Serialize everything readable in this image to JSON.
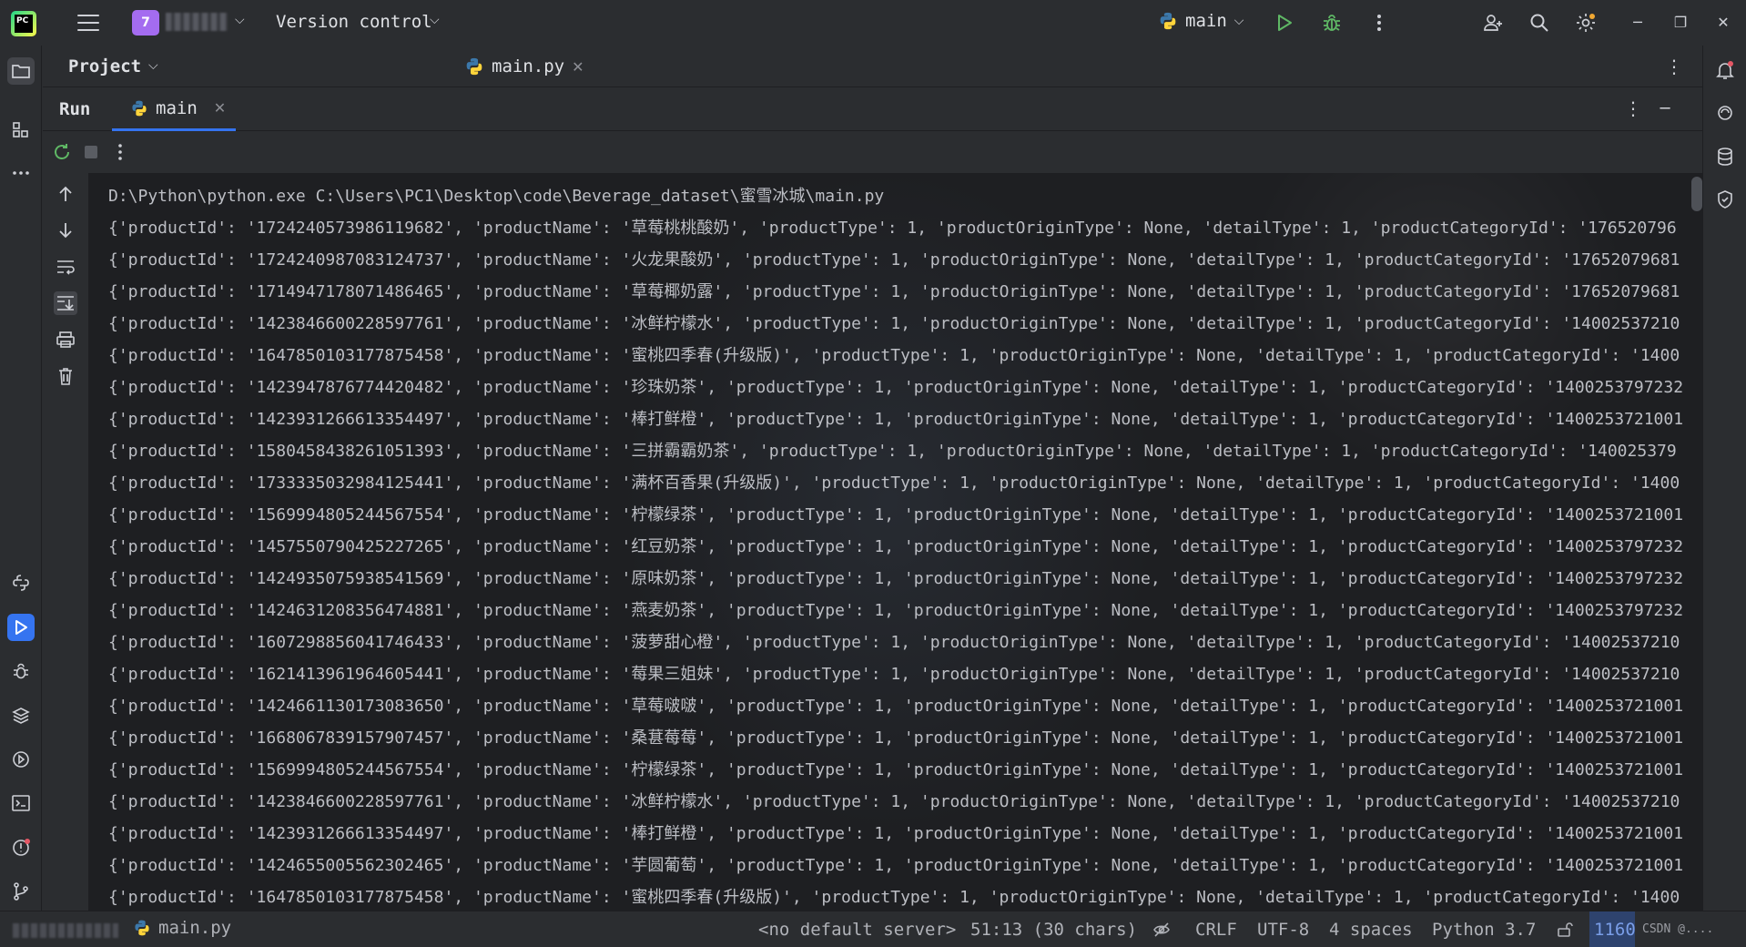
{
  "titlebar": {
    "logo_text": "PC",
    "project_badge": "7",
    "version_control": "Version control",
    "run_config": "main"
  },
  "project_panel": {
    "title": "Project"
  },
  "editor": {
    "tabs": [
      {
        "label": "main.py"
      }
    ]
  },
  "run_panel": {
    "title": "Run",
    "tab_label": "main"
  },
  "console": {
    "lines": [
      "D:\\Python\\python.exe C:\\Users\\PC1\\Desktop\\code\\Beverage_dataset\\蜜雪冰城\\main.py",
      "{'productId': '1724240573986119682', 'productName': '草莓桃桃酸奶', 'productType': 1, 'productOriginType': None, 'detailType': 1, 'productCategoryId': '176520796",
      "{'productId': '1724240987083124737', 'productName': '火龙果酸奶', 'productType': 1, 'productOriginType': None, 'detailType': 1, 'productCategoryId': '17652079681",
      "{'productId': '1714947178071486465', 'productName': '草莓椰奶露', 'productType': 1, 'productOriginType': None, 'detailType': 1, 'productCategoryId': '17652079681",
      "{'productId': '1423846600228597761', 'productName': '冰鲜柠檬水', 'productType': 1, 'productOriginType': None, 'detailType': 1, 'productCategoryId': '14002537210",
      "{'productId': '1647850103177875458', 'productName': '蜜桃四季春(升级版)', 'productType': 1, 'productOriginType': None, 'detailType': 1, 'productCategoryId': '1400",
      "{'productId': '1423947876774420482', 'productName': '珍珠奶茶', 'productType': 1, 'productOriginType': None, 'detailType': 1, 'productCategoryId': '1400253797232",
      "{'productId': '1423931266613354497', 'productName': '棒打鲜橙', 'productType': 1, 'productOriginType': None, 'detailType': 1, 'productCategoryId': '1400253721001",
      "{'productId': '1580458438261051393', 'productName': '三拼霸霸奶茶', 'productType': 1, 'productOriginType': None, 'detailType': 1, 'productCategoryId': '140025379",
      "{'productId': '1733335032984125441', 'productName': '满杯百香果(升级版)', 'productType': 1, 'productOriginType': None, 'detailType': 1, 'productCategoryId': '1400",
      "{'productId': '1569994805244567554', 'productName': '柠檬绿茶', 'productType': 1, 'productOriginType': None, 'detailType': 1, 'productCategoryId': '1400253721001",
      "{'productId': '1457550790425227265', 'productName': '红豆奶茶', 'productType': 1, 'productOriginType': None, 'detailType': 1, 'productCategoryId': '1400253797232",
      "{'productId': '1424935075938541569', 'productName': '原味奶茶', 'productType': 1, 'productOriginType': None, 'detailType': 1, 'productCategoryId': '1400253797232",
      "{'productId': '1424631208356474881', 'productName': '燕麦奶茶', 'productType': 1, 'productOriginType': None, 'detailType': 1, 'productCategoryId': '1400253797232",
      "{'productId': '1607298856041746433', 'productName': '菠萝甜心橙', 'productType': 1, 'productOriginType': None, 'detailType': 1, 'productCategoryId': '14002537210",
      "{'productId': '1621413961964605441', 'productName': '莓果三姐妹', 'productType': 1, 'productOriginType': None, 'detailType': 1, 'productCategoryId': '14002537210",
      "{'productId': '1424661130173083650', 'productName': '草莓啵啵', 'productType': 1, 'productOriginType': None, 'detailType': 1, 'productCategoryId': '1400253721001",
      "{'productId': '1668067839157907457', 'productName': '桑葚莓莓', 'productType': 1, 'productOriginType': None, 'detailType': 1, 'productCategoryId': '1400253721001",
      "{'productId': '1569994805244567554', 'productName': '柠檬绿茶', 'productType': 1, 'productOriginType': None, 'detailType': 1, 'productCategoryId': '1400253721001",
      "{'productId': '1423846600228597761', 'productName': '冰鲜柠檬水', 'productType': 1, 'productOriginType': None, 'detailType': 1, 'productCategoryId': '14002537210",
      "{'productId': '1423931266613354497', 'productName': '棒打鲜橙', 'productType': 1, 'productOriginType': None, 'detailType': 1, 'productCategoryId': '1400253721001",
      "{'productId': '1424655005562302465', 'productName': '芋圆葡萄', 'productType': 1, 'productOriginType': None, 'detailType': 1, 'productCategoryId': '1400253721001",
      "{'productId': '1647850103177875458', 'productName': '蜜桃四季春(升级版)', 'productType': 1, 'productOriginType': None, 'detailType': 1, 'productCategoryId': '1400"
    ]
  },
  "statusbar": {
    "file": "main.py",
    "server": "<no default server>",
    "position": "51:13 (30 chars)",
    "line_separator": "CRLF",
    "encoding": "UTF-8",
    "indent": "4 spaces",
    "interpreter": "Python 3.7",
    "line_count": "1160",
    "watermark": "CSDN @...."
  },
  "colors": {
    "accent": "#3574f0",
    "run_green": "#5fb865",
    "project_badge": "#a46cf0"
  }
}
